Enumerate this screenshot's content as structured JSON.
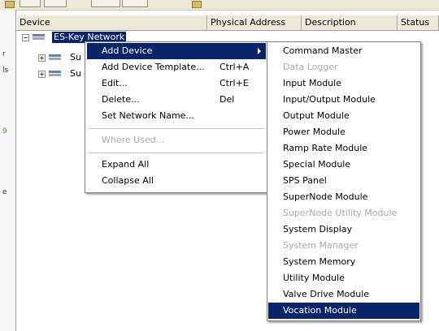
{
  "columns": {
    "device": "Device",
    "physical_address": "Physical Address",
    "description": "Description",
    "status": "Status"
  },
  "tree": {
    "root_label": "ES-Key Network",
    "child_labels": [
      "Su",
      "Su"
    ]
  },
  "left_strip_chars": [
    "r",
    "ls",
    "9",
    "e"
  ],
  "context_menu": {
    "items": [
      {
        "label": "Add Device",
        "shortcut": "",
        "has_submenu": true,
        "highlighted": true,
        "enabled": true
      },
      {
        "label": "Add Device Template...",
        "shortcut": "Ctrl+A",
        "enabled": true
      },
      {
        "label": "Edit...",
        "shortcut": "Ctrl+E",
        "enabled": true
      },
      {
        "label": "Delete...",
        "shortcut": "Del",
        "enabled": true
      },
      {
        "label": "Set Network Name...",
        "shortcut": "",
        "enabled": true
      },
      {
        "label": "Where Used...",
        "shortcut": "",
        "enabled": false
      },
      {
        "label": "Expand All",
        "shortcut": "",
        "enabled": true
      },
      {
        "label": "Collapse All",
        "shortcut": "",
        "enabled": true
      }
    ]
  },
  "submenu": {
    "items": [
      {
        "label": "Command Master",
        "enabled": true
      },
      {
        "label": "Data Logger",
        "enabled": false
      },
      {
        "label": "Input Module",
        "enabled": true
      },
      {
        "label": "Input/Output Module",
        "enabled": true
      },
      {
        "label": "Output Module",
        "enabled": true
      },
      {
        "label": "Power Module",
        "enabled": true
      },
      {
        "label": "Ramp Rate Module",
        "enabled": true
      },
      {
        "label": "Special Module",
        "enabled": true
      },
      {
        "label": "SPS Panel",
        "enabled": true
      },
      {
        "label": "SuperNode Module",
        "enabled": true
      },
      {
        "label": "SuperNode Utility Module",
        "enabled": false
      },
      {
        "label": "System Display",
        "enabled": true
      },
      {
        "label": "System Manager",
        "enabled": false
      },
      {
        "label": "System Memory",
        "enabled": true
      },
      {
        "label": "Utility Module",
        "enabled": true
      },
      {
        "label": "Valve Drive Module",
        "enabled": true
      },
      {
        "label": "Vocation Module",
        "enabled": true,
        "highlighted": true
      }
    ]
  },
  "colors": {
    "selection": "#0a246a",
    "disabled_text": "#a8a8a8",
    "header_bg": "#ece9d8"
  }
}
